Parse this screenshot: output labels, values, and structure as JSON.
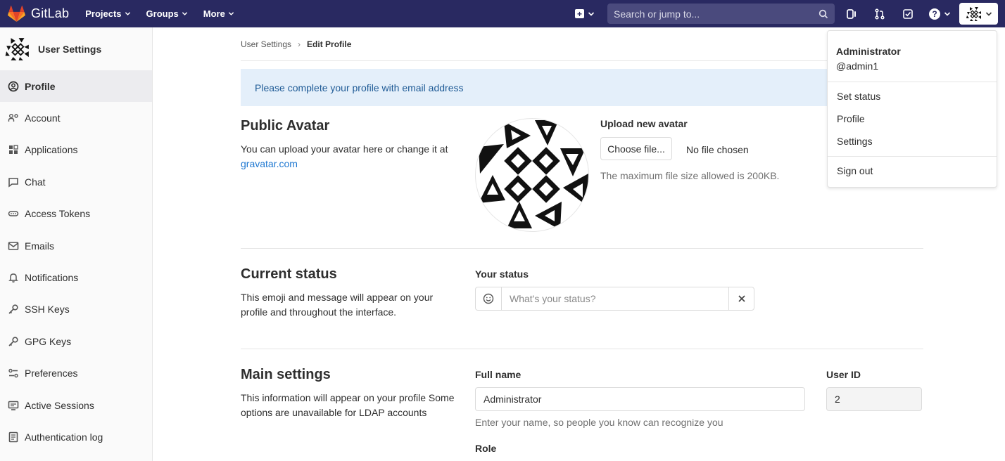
{
  "topnav": {
    "brand": "GitLab",
    "links": [
      "Projects",
      "Groups",
      "More"
    ],
    "search_placeholder": "Search or jump to..."
  },
  "sidebar": {
    "title": "User Settings",
    "items": [
      {
        "label": "Profile",
        "icon": "profile-icon",
        "active": true
      },
      {
        "label": "Account",
        "icon": "account-icon"
      },
      {
        "label": "Applications",
        "icon": "applications-icon"
      },
      {
        "label": "Chat",
        "icon": "chat-icon"
      },
      {
        "label": "Access Tokens",
        "icon": "access-tokens-icon"
      },
      {
        "label": "Emails",
        "icon": "emails-icon"
      },
      {
        "label": "Notifications",
        "icon": "notifications-icon"
      },
      {
        "label": "SSH Keys",
        "icon": "ssh-keys-icon"
      },
      {
        "label": "GPG Keys",
        "icon": "gpg-keys-icon"
      },
      {
        "label": "Preferences",
        "icon": "preferences-icon"
      },
      {
        "label": "Active Sessions",
        "icon": "active-sessions-icon"
      },
      {
        "label": "Authentication log",
        "icon": "authentication-log-icon"
      }
    ]
  },
  "breadcrumb": {
    "parent": "User Settings",
    "current": "Edit Profile"
  },
  "alert": "Please complete your profile with email address",
  "avatar_section": {
    "title": "Public Avatar",
    "desc": "You can upload your avatar here or change it at",
    "link": "gravatar.com",
    "upload_title": "Upload new avatar",
    "choose_button": "Choose file...",
    "no_file": "No file chosen",
    "max_size": "The maximum file size allowed is 200KB."
  },
  "status_section": {
    "title": "Current status",
    "desc": "This emoji and message will appear on your profile and throughout the interface.",
    "label": "Your status",
    "placeholder": "What's your status?"
  },
  "main_section": {
    "title": "Main settings",
    "desc": "This information will appear on your profile Some options are unavailable for LDAP accounts",
    "full_name_label": "Full name",
    "full_name_value": "Administrator",
    "full_name_help": "Enter your name, so people you know can recognize you",
    "user_id_label": "User ID",
    "user_id_value": "2",
    "role_label": "Role"
  },
  "dropdown": {
    "name": "Administrator",
    "username": "@admin1",
    "items": [
      "Set status",
      "Profile",
      "Settings"
    ],
    "sign_out": "Sign out"
  },
  "colors": {
    "nav_bg": "#292961",
    "link": "#1f78d1",
    "alert_bg": "#e4effa"
  }
}
